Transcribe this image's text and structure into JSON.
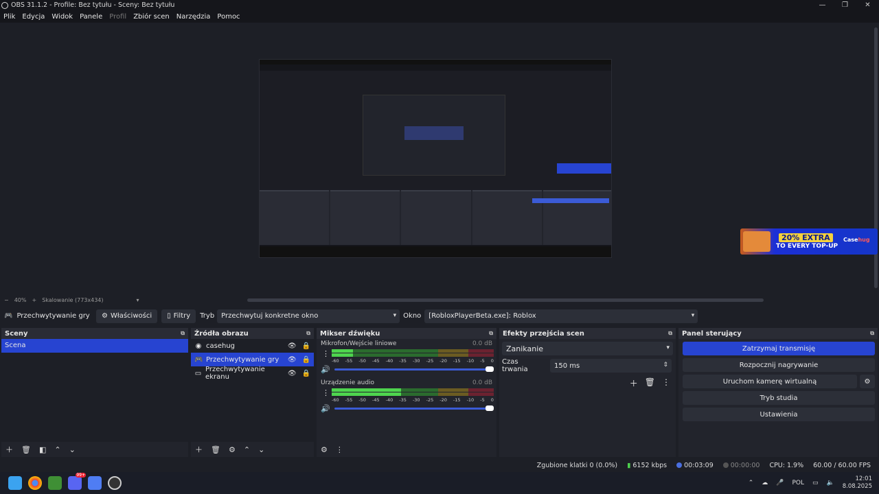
{
  "window": {
    "title": "OBS 31.1.2 - Profile: Bez tytułu - Sceny: Bez tytułu",
    "controls": [
      "—",
      "❐",
      "✕"
    ]
  },
  "menu": [
    "Plik",
    "Edycja",
    "Widok",
    "Panele",
    "Profil",
    "Zbiór scen",
    "Narzędzia",
    "Pomoc"
  ],
  "zoom": {
    "minus": "−",
    "value": "40%",
    "plus": "+",
    "scaling": "Skalowanie (773x434)"
  },
  "ad": {
    "line1": "20% EXTRA",
    "line2": "TO EVERY TOP-UP",
    "logo_a": "Case",
    "logo_b": "hug"
  },
  "properties_bar": {
    "source_name": "Przechwytywanie gry",
    "properties_label": "Właściwości",
    "filters_label": "Filtry",
    "mode_label": "Tryb",
    "mode_value": "Przechwytuj konkretne okno",
    "window_label": "Okno",
    "window_value": "[RobloxPlayerBeta.exe]: Roblox"
  },
  "scenes": {
    "title": "Sceny",
    "items": [
      "Scena"
    ]
  },
  "sources": {
    "title": "Źródła obrazu",
    "items": [
      "casehug",
      "Przechwytywanie gry",
      "Przechwytywanie ekranu"
    ]
  },
  "mixer": {
    "title": "Mikser dźwięku",
    "scale": [
      "-60",
      "-55",
      "-50",
      "-45",
      "-40",
      "-35",
      "-30",
      "-25",
      "-20",
      "-15",
      "-10",
      "-5",
      "0"
    ],
    "tracks": [
      {
        "name": "Mikrofon/Wejście liniowe",
        "db": "0.0 dB",
        "level": 0.13
      },
      {
        "name": "Urządzenie audio",
        "db": "0.0 dB",
        "level": 0.43
      }
    ]
  },
  "transitions": {
    "title": "Efekty przejścia scen",
    "value": "Zanikanie",
    "duration_label": "Czas trwania",
    "duration_value": "150 ms"
  },
  "controls": {
    "title": "Panel sterujący",
    "stop_stream": "Zatrzymaj transmisję",
    "start_recording": "Rozpocznij nagrywanie",
    "virtual_cam": "Uruchom kamerę wirtualną",
    "studio_mode": "Tryb studia",
    "settings": "Ustawienia"
  },
  "status": {
    "dropped": "Zgubione klatki 0 (0.0%)",
    "bitrate": "6152 kbps",
    "stream_time": "00:03:09",
    "rec_time": "00:00:00",
    "cpu": "CPU: 1.9%",
    "fps": "60.00 / 60.00 FPS"
  },
  "taskbar": {
    "lang": "POL",
    "time": "12:01",
    "date": "8.08.2025",
    "discord_badge": "99+"
  },
  "colors": {
    "accent": "#2744d1",
    "bg": "#1d1f26",
    "dock": "#22242c"
  }
}
